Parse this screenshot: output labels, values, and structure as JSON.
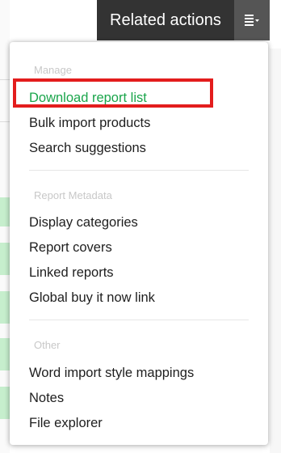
{
  "header": {
    "title": "Related actions",
    "toggle_icon": "list-menu-icon"
  },
  "menu": {
    "sections": [
      {
        "header": "Manage",
        "items": [
          "Download report list",
          "Bulk import products",
          "Search suggestions"
        ]
      },
      {
        "header": "Report Metadata",
        "items": [
          "Display categories",
          "Report covers",
          "Linked reports",
          "Global buy it now link"
        ]
      },
      {
        "header": "Other",
        "items": [
          "Word import style mappings",
          "Notes",
          "File explorer"
        ]
      }
    ],
    "highlighted_item": "Download report list"
  },
  "colors": {
    "header_bg": "#333333",
    "toggle_bg": "#555555",
    "active_item": "#1aa54b",
    "highlight_border": "#e31d1d"
  }
}
